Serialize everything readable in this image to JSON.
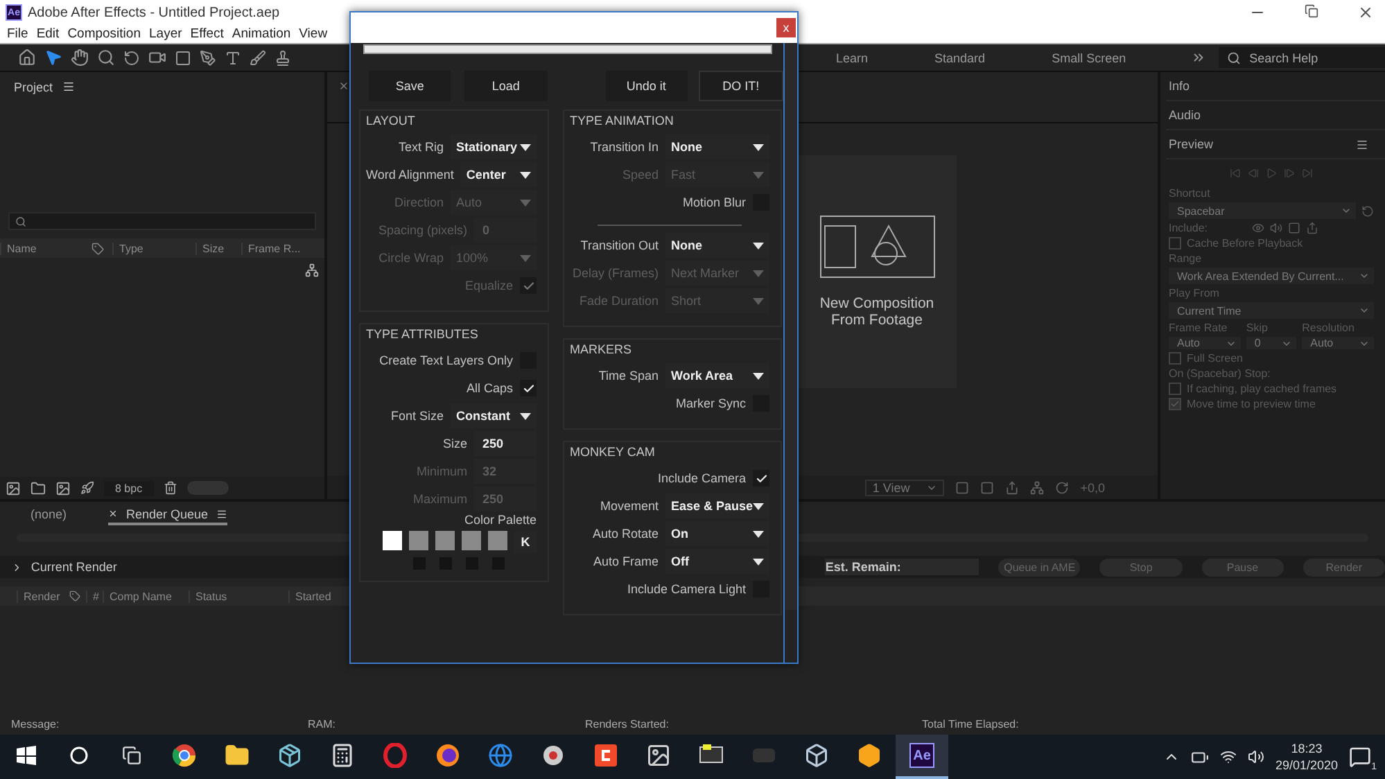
{
  "app": {
    "logo": "Ae",
    "title": "Adobe After Effects - Untitled Project.aep",
    "menu": [
      "File",
      "Edit",
      "Composition",
      "Layer",
      "Effect",
      "Animation",
      "View"
    ]
  },
  "toolbar": {
    "workspaces": [
      "Learn",
      "Standard",
      "Small Screen"
    ],
    "search_placeholder": "Search Help"
  },
  "project_panel": {
    "title": "Project",
    "columns": [
      "Name",
      "Type",
      "Size",
      "Frame R..."
    ],
    "bit_depth": "8 bpc"
  },
  "viewer": {
    "new_comp_label": "New Composition From Footage",
    "views": "1 View",
    "offset": "+0,0"
  },
  "side_panels": [
    {
      "title": "Info",
      "menu": false
    },
    {
      "title": "Audio",
      "menu": false
    },
    {
      "title": "Preview",
      "menu": true
    }
  ],
  "preview": {
    "shortcut_label": "Shortcut",
    "shortcut": "Spacebar",
    "include_label": "Include:",
    "cache": {
      "label": "Cache Before Playback",
      "checked": false
    },
    "range_label": "Range",
    "range": "Work Area Extended By Current...",
    "play_from_label": "Play From",
    "play_from": "Current Time",
    "rate_fields": [
      {
        "label": "Frame Rate",
        "value": "Auto"
      },
      {
        "label": "Skip",
        "value": "0"
      },
      {
        "label": "Resolution",
        "value": "Auto"
      }
    ],
    "full_screen": {
      "label": "Full Screen",
      "checked": false
    },
    "stop_label": "On (Spacebar) Stop:",
    "stop_options": [
      {
        "label": "If caching, play cached frames",
        "checked": false
      },
      {
        "label": "Move time to preview time",
        "checked": true
      }
    ]
  },
  "render_queue": {
    "tabs": [
      {
        "label": "(none)",
        "selected": false,
        "closable": false
      },
      {
        "label": "Render Queue",
        "selected": true,
        "closable": true
      }
    ],
    "current_render": "Current Render",
    "est_remain": "Est. Remain:",
    "buttons": [
      "Queue in AME",
      "Stop",
      "Pause",
      "Render"
    ],
    "columns": [
      "Render",
      "#",
      "Comp Name",
      "Status",
      "Started"
    ]
  },
  "status_bar": [
    "Message:",
    "RAM:",
    "Renders Started:",
    "Total Time Elapsed:"
  ],
  "dialog": {
    "close": "x",
    "actions_left": [
      "Save",
      "Load"
    ],
    "actions_right": [
      "Undo it",
      "DO IT!"
    ],
    "columns": [
      [
        {
          "title": "LAYOUT",
          "rows": [
            {
              "kind": "dropdown",
              "label": "Text Rig",
              "value": "Stationary",
              "disabled": false
            },
            {
              "kind": "dropdown",
              "label": "Word Alignment",
              "value": "Center",
              "disabled": false
            },
            {
              "kind": "dropdown",
              "label": "Direction",
              "value": "Auto",
              "disabled": true
            },
            {
              "kind": "number",
              "label": "Spacing (pixels)",
              "value": "0",
              "disabled": true
            },
            {
              "kind": "dropdown",
              "label": "Circle Wrap",
              "value": "100%",
              "disabled": true
            },
            {
              "kind": "checkbox",
              "label": "Equalize",
              "checked": true,
              "disabled": true
            }
          ]
        },
        {
          "title": "TYPE ATTRIBUTES",
          "rows": [
            {
              "kind": "checkbox",
              "label": "Create Text Layers Only",
              "checked": false,
              "disabled": false
            },
            {
              "kind": "checkbox",
              "label": "All Caps",
              "checked": true,
              "disabled": false
            },
            {
              "kind": "dropdown",
              "label": "Font Size",
              "value": "Constant",
              "disabled": false
            },
            {
              "kind": "number",
              "label": "Size",
              "value": "250",
              "disabled": false
            },
            {
              "kind": "number",
              "label": "Minimum",
              "value": "32",
              "disabled": true
            },
            {
              "kind": "number",
              "label": "Maximum",
              "value": "250",
              "disabled": true
            },
            {
              "kind": "palette",
              "label": "Color Palette",
              "key": "K",
              "swatches": [
                {
                  "color": "#ffffff",
                  "has_slot": false
                },
                {
                  "color": "#8a8a8a",
                  "has_slot": true
                },
                {
                  "color": "#8a8a8a",
                  "has_slot": true
                },
                {
                  "color": "#8a8a8a",
                  "has_slot": true
                },
                {
                  "color": "#8a8a8a",
                  "has_slot": true
                }
              ]
            }
          ]
        }
      ],
      [
        {
          "title": "TYPE ANIMATION",
          "rows": [
            {
              "kind": "dropdown",
              "label": "Transition In",
              "value": "None",
              "disabled": false
            },
            {
              "kind": "dropdown",
              "label": "Speed",
              "value": "Fast",
              "disabled": true
            },
            {
              "kind": "checkbox",
              "label": "Motion Blur",
              "checked": false,
              "disabled": false
            },
            {
              "kind": "separator"
            },
            {
              "kind": "dropdown",
              "label": "Transition Out",
              "value": "None",
              "disabled": false
            },
            {
              "kind": "dropdown",
              "label": "Delay (Frames)",
              "value": "Next Marker",
              "disabled": true
            },
            {
              "kind": "dropdown",
              "label": "Fade Duration",
              "value": "Short",
              "disabled": true
            }
          ]
        },
        {
          "title": "MARKERS",
          "rows": [
            {
              "kind": "dropdown",
              "label": "Time Span",
              "value": "Work Area",
              "disabled": false
            },
            {
              "kind": "checkbox",
              "label": "Marker Sync",
              "checked": false,
              "disabled": false
            }
          ]
        },
        {
          "title": "MONKEY CAM",
          "rows": [
            {
              "kind": "checkbox",
              "label": "Include Camera",
              "checked": true,
              "disabled": false
            },
            {
              "kind": "dropdown",
              "label": "Movement",
              "value": "Ease & Pause",
              "disabled": false
            },
            {
              "kind": "dropdown",
              "label": "Auto Rotate",
              "value": "On",
              "disabled": false
            },
            {
              "kind": "dropdown",
              "label": "Auto Frame",
              "value": "Off",
              "disabled": false
            },
            {
              "kind": "checkbox",
              "label": "Include Camera Light",
              "checked": false,
              "disabled": false
            }
          ]
        }
      ]
    ]
  },
  "taskbar": {
    "active_app": "Ae",
    "time": "18:23",
    "date": "29/01/2020",
    "notifications": "1"
  }
}
